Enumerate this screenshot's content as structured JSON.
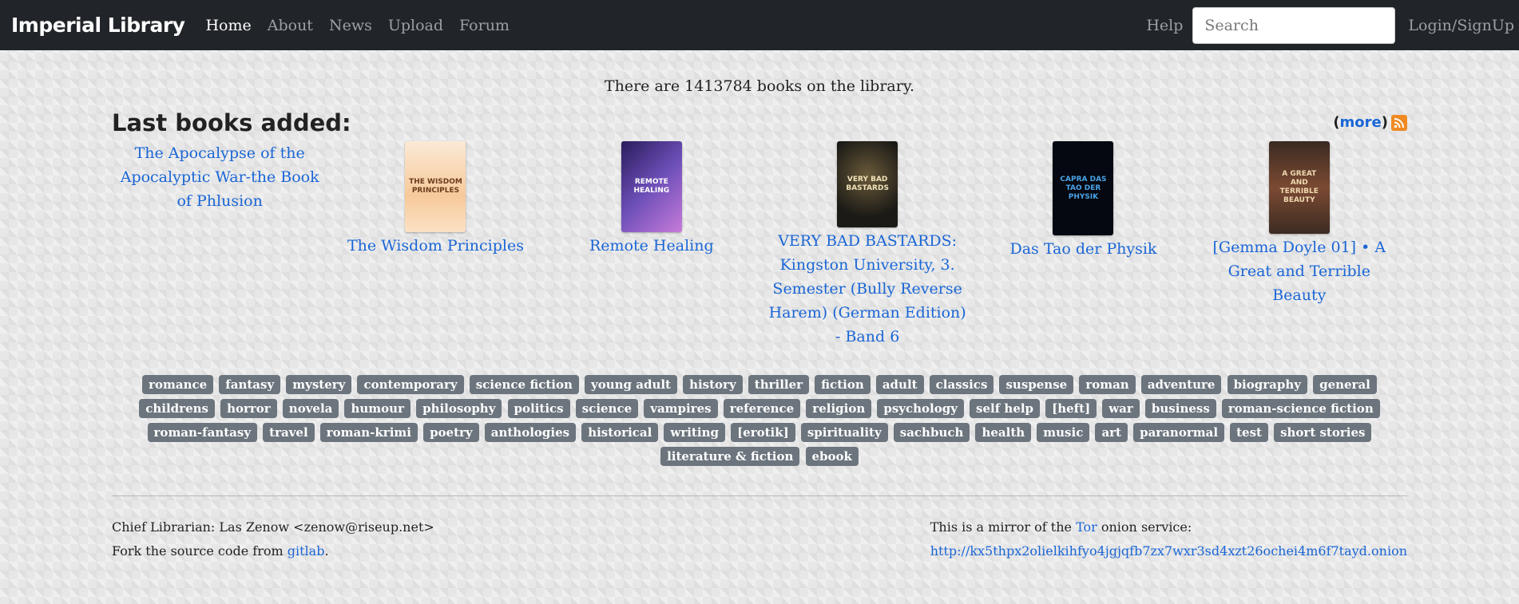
{
  "nav": {
    "brand": "Imperial Library",
    "links": [
      "Home",
      "About",
      "News",
      "Upload",
      "Forum"
    ],
    "help": "Help",
    "search_placeholder": "Search",
    "login": "Login/SignUp"
  },
  "book_count_text": "There are 1413784 books on the library.",
  "last_added": {
    "title": "Last books added:",
    "more_paren_open": "(",
    "more": "more",
    "more_paren_close": ")",
    "books": [
      {
        "title": "The Apocalypse of the Apocalyptic War-the Book of Phlusion",
        "cover_text": ""
      },
      {
        "title": "The Wisdom Principles",
        "cover_text": "THE WISDOM PRINCIPLES"
      },
      {
        "title": "Remote Healing",
        "cover_text": "REMOTE HEALING"
      },
      {
        "title": "VERY BAD BASTARDS: Kingston University, 3. Semester (Bully Reverse Harem) (German Edition) - Band 6",
        "cover_text": "VERY BAD BASTARDS"
      },
      {
        "title": "Das Tao der Physik",
        "cover_text": "CAPRA DAS TAO DER PHYSIK"
      },
      {
        "title": "[Gemma Doyle 01] • A Great and Terrible Beauty",
        "cover_text": "A GREAT AND TERRIBLE BEAUTY"
      }
    ]
  },
  "tags": [
    "romance",
    "fantasy",
    "mystery",
    "contemporary",
    "science fiction",
    "young adult",
    "history",
    "thriller",
    "fiction",
    "adult",
    "classics",
    "suspense",
    "roman",
    "adventure",
    "biography",
    "general",
    "childrens",
    "horror",
    "novela",
    "humour",
    "philosophy",
    "politics",
    "science",
    "vampires",
    "reference",
    "religion",
    "psychology",
    "self help",
    "[heft]",
    "war",
    "business",
    "roman-science fiction",
    "roman-fantasy",
    "travel",
    "roman-krimi",
    "poetry",
    "anthologies",
    "historical",
    "writing",
    "[erotik]",
    "spirituality",
    "sachbuch",
    "health",
    "music",
    "art",
    "paranormal",
    "test",
    "short stories",
    "literature & fiction",
    "ebook"
  ],
  "footer": {
    "librarian": "Chief Librarian: Las Zenow <zenow@riseup.net>",
    "fork_prefix": "Fork the source code from ",
    "fork_link": "gitlab",
    "fork_suffix": ".",
    "mirror_prefix": "This is a mirror of the ",
    "mirror_link": "Tor",
    "mirror_suffix": " onion service:",
    "onion_url": "http://kx5thpx2olielkihfyo4jgjqfb7zx7wxr3sd4xzt26ochei4m6f7tayd.onion"
  }
}
